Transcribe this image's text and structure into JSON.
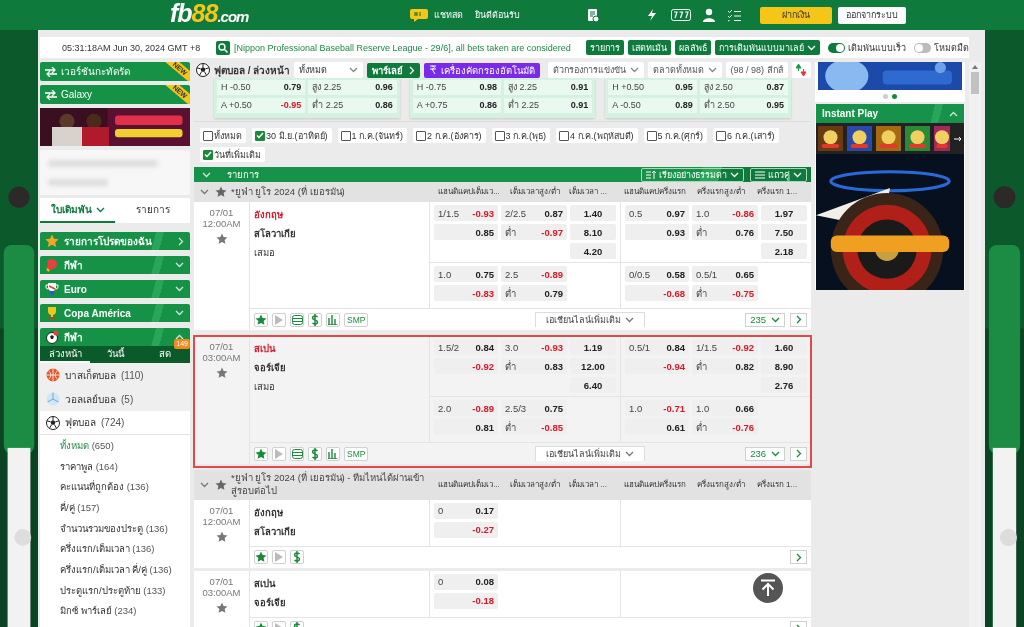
{
  "header": {
    "logo": {
      "part_1": "fb",
      "part_2": "88",
      "part_3": ".com"
    },
    "chat": "แชทสด",
    "welcome": "ยินดีต้อนรับ",
    "deposit": "ฝากเงิน",
    "logout": "ออกจากระบบ"
  },
  "topbar": {
    "time": "05:31:18AM Jun 30, 2024 GMT +8",
    "ticker": "[Nippon Professional Baseball Reserve League - 29/6], all bets taken are considered",
    "buttons": [
      {
        "label": "รายการ",
        "dropdown": false
      },
      {
        "label": "เสตทเม้น",
        "dropdown": false
      },
      {
        "label": "ผลลัพธ์",
        "dropdown": false
      },
      {
        "label": "การเดิมพันแบบมาเลย์",
        "dropdown": true
      }
    ],
    "toggles": [
      {
        "label": "เดิมพันแบบเร็ว",
        "on": true
      },
      {
        "label": "โหมดมืด",
        "on": false
      }
    ]
  },
  "sidebar": {
    "promos": [
      {
        "label": "เวอร์ชันกะทัดรัด",
        "badge": "NEW"
      },
      {
        "label": "Galaxy",
        "badge": "NEW"
      }
    ],
    "tabs": [
      {
        "label": "ใบเดิมพัน",
        "selected": true
      },
      {
        "label": "รายการ",
        "selected": false
      }
    ],
    "sections": [
      {
        "label": "รายการโปรดของฉัน",
        "kind": "link"
      },
      {
        "label": "กีฬา",
        "kind": "group",
        "expanded": false
      },
      {
        "label": "Euro",
        "kind": "group",
        "expanded": false
      },
      {
        "label": "Copa América",
        "kind": "group",
        "expanded": false
      },
      {
        "label": "กีฬา",
        "kind": "group",
        "expanded": true
      }
    ],
    "subtabs": [
      {
        "label": "ล่วงหน้า",
        "selected": true
      },
      {
        "label": "วันนี้",
        "selected": false
      },
      {
        "label": "สด",
        "selected": false,
        "badge": "149"
      }
    ],
    "sports": [
      {
        "label": "บาสเก็ตบอล",
        "count": "(110)"
      },
      {
        "label": "วอลเลย์บอล",
        "count": "(5)"
      },
      {
        "label": "ฟุตบอล",
        "count": "(724)",
        "children": [
          {
            "label": "ทั้งหมด",
            "count": "(650)",
            "selected": true
          },
          {
            "label": "ราคาพูล",
            "count": "(164)",
            "selected": false
          },
          {
            "label": "คะแนนที่ถูกต้อง",
            "count": "(136)",
            "selected": false
          },
          {
            "label": "คี่/คู่",
            "count": "(157)",
            "selected": false
          },
          {
            "label": "จำนวนรวมของประตู",
            "count": "(136)",
            "selected": false
          },
          {
            "label": "ครึ่งแรก/เต็มเวลา",
            "count": "(136)",
            "selected": false
          },
          {
            "label": "ครึ่งแรก/เต็มเวลา คี่/คู่",
            "count": "(136)",
            "selected": false
          },
          {
            "label": "ประตูแรก/ประตูท้าย",
            "count": "(133)",
            "selected": false
          },
          {
            "label": "มิกซ์ พาร์เลย์",
            "count": "(234)",
            "selected": false
          }
        ]
      }
    ]
  },
  "toolbar": {
    "title": "ฟุตบอล / ล่วงหน้า",
    "select": "ทั้งหมด",
    "parlay": "พาร์เลย์",
    "auto_filter": "เครื่องคัดกรองอัตโนมัติ",
    "match_filter": "ตัวกรองการแข่งขัน",
    "markets": "ตลาดทั้งหมด",
    "leagues": "(98 / 98) ลีกส์"
  },
  "featured": [
    {
      "rows": [
        [
          {
            "label": "H -0.50",
            "odds": "0.79",
            "negative": false
          },
          {
            "label": "สูง 2.25",
            "odds": "0.96",
            "negative": false
          }
        ],
        [
          {
            "label": "A +0.50",
            "odds": "-0.95",
            "negative": true
          },
          {
            "label": "ต่ำ 2.25",
            "odds": "0.86",
            "negative": false
          }
        ]
      ]
    },
    {
      "rows": [
        [
          {
            "label": "H -0.75",
            "odds": "0.98",
            "negative": false
          },
          {
            "label": "สูง 2.25",
            "odds": "0.91",
            "negative": false
          }
        ],
        [
          {
            "label": "A +0.75",
            "odds": "0.86",
            "negative": false
          },
          {
            "label": "ต่ำ 2.25",
            "odds": "0.91",
            "negative": false
          }
        ]
      ]
    },
    {
      "rows": [
        [
          {
            "label": "H +0.50",
            "odds": "0.95",
            "negative": false
          },
          {
            "label": "สูง 2.50",
            "odds": "0.87",
            "negative": false
          }
        ],
        [
          {
            "label": "A -0.50",
            "odds": "0.89",
            "negative": false
          },
          {
            "label": "ต่ำ 2.50",
            "odds": "0.95",
            "negative": false
          }
        ]
      ]
    }
  ],
  "date_filters": [
    {
      "label": "ทั้งหมด",
      "checked": false
    },
    {
      "label": "30 มิ.ย.(อาทิตย์)",
      "checked": true
    },
    {
      "label": "1 ก.ค.(จันทร์)",
      "checked": false
    },
    {
      "label": "2 ก.ค.(อังคาร)",
      "checked": false
    },
    {
      "label": "3 ก.ค.(พุธ)",
      "checked": false
    },
    {
      "label": "4 ก.ค.(พฤหัสบดี)",
      "checked": false
    },
    {
      "label": "5 ก.ค.(ศุกร์)",
      "checked": false
    },
    {
      "label": "6 ก.ค.(เสาร์)",
      "checked": false
    },
    {
      "label": "วันที่เพิ่มเติม",
      "checked": true
    }
  ],
  "list_header": {
    "title": "รายการ",
    "sort": "เรียงอย่างธรรมดา",
    "view": "แถวคู่"
  },
  "leagues": [
    {
      "name": "*ยูฟ่า ยูโร 2024 (ที่ เยอรมัน)",
      "columns": [
        "แฮนดิแคปเต็มเว...",
        "เต็มเวลาสูง/ต่ำ",
        "เต็มเวลา ...",
        "แฮนดิแคปครึ่งแรก",
        "ครึ่งแรกสูง/ต่ำ",
        "ครึ่งแรก 1..."
      ],
      "matches": [
        {
          "date": "07/01",
          "time": "12:00AM",
          "selected": false,
          "teams": [
            {
              "name": "อังกฤษ",
              "highlighted": true
            },
            {
              "name": "สโลวาเกีย",
              "highlighted": false
            },
            {
              "name": "เสมอ",
              "highlighted": false
            }
          ],
          "lines": [
            {
              "hdp": [
                {
                  "line": "1/1.5",
                  "odds": "-0.93",
                  "negative": true
                },
                {
                  "odds": "0.85",
                  "negative": false
                }
              ],
              "ou": [
                {
                  "line": "2/2.5",
                  "odds": "0.87",
                  "negative": false
                },
                {
                  "line": "ต่ำ",
                  "odds": "-0.97",
                  "negative": true
                }
              ],
              "x12": [
                {
                  "odds": "1.40",
                  "negative": false
                },
                {
                  "odds": "8.10",
                  "negative": false
                },
                {
                  "odds": "4.20",
                  "negative": false
                }
              ],
              "hdp_1h": [
                {
                  "line": "0.5",
                  "odds": "0.97",
                  "negative": false
                },
                {
                  "odds": "0.93",
                  "negative": false
                }
              ],
              "ou_1h": [
                {
                  "line": "1.0",
                  "odds": "-0.86",
                  "negative": true
                },
                {
                  "line": "ต่ำ",
                  "odds": "0.76",
                  "negative": false
                }
              ],
              "x12_1h": [
                {
                  "odds": "1.97",
                  "negative": false
                },
                {
                  "odds": "7.50",
                  "negative": false
                },
                {
                  "odds": "2.18",
                  "negative": false
                }
              ]
            },
            {
              "hdp": [
                {
                  "line": "1.0",
                  "odds": "0.75",
                  "negative": false
                },
                {
                  "odds": "-0.83",
                  "negative": true
                }
              ],
              "ou": [
                {
                  "line": "2.5",
                  "odds": "-0.89",
                  "negative": true
                },
                {
                  "line": "ต่ำ",
                  "odds": "0.79",
                  "negative": false
                }
              ],
              "hdp_1h": [
                {
                  "line": "0/0.5",
                  "odds": "0.58",
                  "negative": false
                },
                {
                  "odds": "-0.68",
                  "negative": true
                }
              ],
              "ou_1h": [
                {
                  "line": "0.5/1",
                  "odds": "0.65",
                  "negative": false
                },
                {
                  "line": "ต่ำ",
                  "odds": "-0.75",
                  "negative": true
                }
              ]
            }
          ],
          "tools": [
            {
              "kind": "star"
            },
            {
              "kind": "play"
            },
            {
              "kind": "list"
            },
            {
              "kind": "dollar"
            },
            {
              "kind": "stats"
            },
            {
              "kind": "text",
              "label": "SMP"
            }
          ],
          "more_lines": "เอเชียนไลน์เพิ่มเติม",
          "count": "235"
        },
        {
          "date": "07/01",
          "time": "03:00AM",
          "selected": true,
          "teams": [
            {
              "name": "สเปน",
              "highlighted": true
            },
            {
              "name": "จอร์เจีย",
              "highlighted": false
            },
            {
              "name": "เสมอ",
              "highlighted": false
            }
          ],
          "lines": [
            {
              "hdp": [
                {
                  "line": "1.5/2",
                  "odds": "0.84",
                  "negative": false
                },
                {
                  "odds": "-0.92",
                  "negative": true
                }
              ],
              "ou": [
                {
                  "line": "3.0",
                  "odds": "-0.93",
                  "negative": true
                },
                {
                  "line": "ต่ำ",
                  "odds": "0.83",
                  "negative": false
                }
              ],
              "x12": [
                {
                  "odds": "1.19",
                  "negative": false
                },
                {
                  "odds": "12.00",
                  "negative": false
                },
                {
                  "odds": "6.40",
                  "negative": false
                }
              ],
              "hdp_1h": [
                {
                  "line": "0.5/1",
                  "odds": "0.84",
                  "negative": false
                },
                {
                  "odds": "-0.94",
                  "negative": true
                }
              ],
              "ou_1h": [
                {
                  "line": "1/1.5",
                  "odds": "-0.92",
                  "negative": true
                },
                {
                  "line": "ต่ำ",
                  "odds": "0.82",
                  "negative": false
                }
              ],
              "x12_1h": [
                {
                  "odds": "1.60",
                  "negative": false
                },
                {
                  "odds": "8.90",
                  "negative": false
                },
                {
                  "odds": "2.76",
                  "negative": false
                }
              ]
            },
            {
              "hdp": [
                {
                  "line": "2.0",
                  "odds": "-0.89",
                  "negative": true
                },
                {
                  "odds": "0.81",
                  "negative": false
                }
              ],
              "ou": [
                {
                  "line": "2.5/3",
                  "odds": "0.75",
                  "negative": false
                },
                {
                  "line": "ต่ำ",
                  "odds": "-0.85",
                  "negative": true
                }
              ],
              "hdp_1h": [
                {
                  "line": "1.0",
                  "odds": "-0.71",
                  "negative": true
                },
                {
                  "odds": "0.61",
                  "negative": false
                }
              ],
              "ou_1h": [
                {
                  "line": "1.0",
                  "odds": "0.66",
                  "negative": false
                },
                {
                  "line": "ต่ำ",
                  "odds": "-0.76",
                  "negative": true
                }
              ]
            }
          ],
          "tools": [
            {
              "kind": "star"
            },
            {
              "kind": "play"
            },
            {
              "kind": "list"
            },
            {
              "kind": "dollar"
            },
            {
              "kind": "stats"
            },
            {
              "kind": "text",
              "label": "SMP"
            }
          ],
          "more_lines": "เอเชียนไลน์เพิ่มเติม",
          "count": "236"
        }
      ]
    },
    {
      "name": "*ยูฟ่า ยูโร 2024 (ที่ เยอรมัน) - ทีมไหนได้ผ่านเข้าสู่รอบต่อไป",
      "columns": [
        "แฮนดิแคปเต็มเว...",
        "เต็มเวลาสูง/ต่ำ",
        "เต็มเวลา ...",
        "แฮนดิแคปครึ่งแรก",
        "ครึ่งแรกสูง/ต่ำ",
        "ครึ่งแรก 1..."
      ],
      "matches": [
        {
          "date": "07/01",
          "time": "12:00AM",
          "selected": false,
          "teams": [
            {
              "name": "อังกฤษ",
              "highlighted": false
            },
            {
              "name": "สโลวาเกีย",
              "highlighted": false
            }
          ],
          "lines": [
            {
              "hdp": [
                {
                  "line": "0",
                  "odds": "0.17",
                  "negative": false
                },
                {
                  "odds": "-0.27",
                  "negative": true
                }
              ]
            }
          ],
          "tools": [
            {
              "kind": "star"
            },
            {
              "kind": "play"
            },
            {
              "kind": "dollar"
            }
          ]
        },
        {
          "date": "07/01",
          "time": "03:00AM",
          "selected": false,
          "teams": [
            {
              "name": "สเปน",
              "highlighted": false
            },
            {
              "name": "จอร์เจีย",
              "highlighted": false
            }
          ],
          "lines": [
            {
              "hdp": [
                {
                  "line": "0",
                  "odds": "0.08",
                  "negative": false
                },
                {
                  "odds": "-0.18",
                  "negative": true
                }
              ]
            }
          ],
          "tools": [
            {
              "kind": "star"
            },
            {
              "kind": "play"
            },
            {
              "kind": "dollar"
            }
          ]
        }
      ]
    }
  ],
  "right_panel": {
    "slides": [
      {
        "selected": false
      },
      {
        "selected": true
      }
    ],
    "instant_play": {
      "title": "Instant Play",
      "expanded": true
    }
  }
}
